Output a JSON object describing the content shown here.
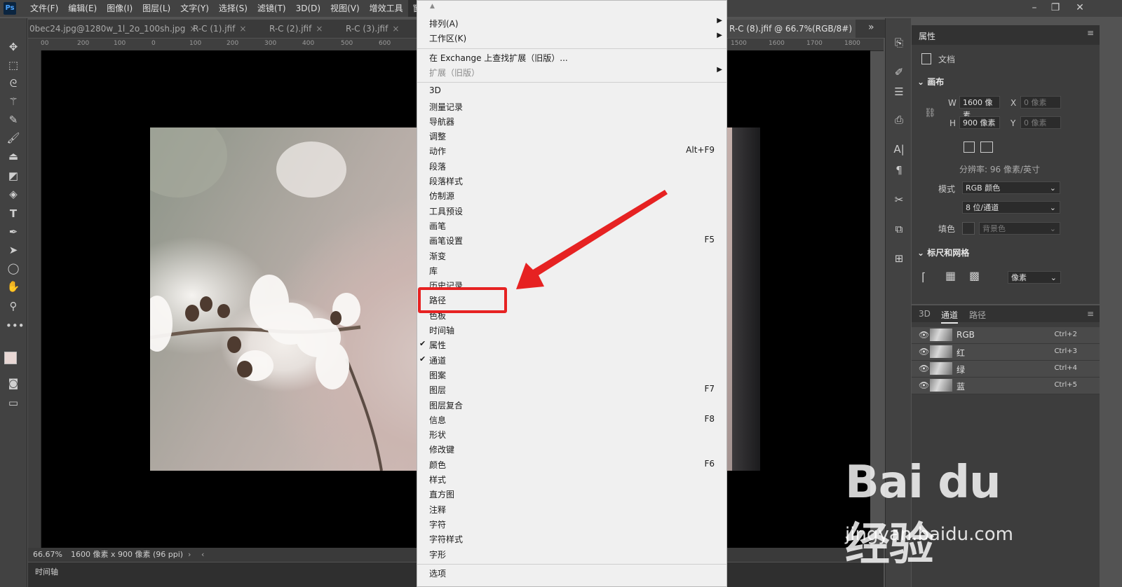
{
  "app": {
    "logo": "Ps"
  },
  "menubar": {
    "items": [
      "文件(F)",
      "编辑(E)",
      "图像(I)",
      "图层(L)",
      "文字(Y)",
      "选择(S)",
      "滤镜(T)",
      "3D(D)",
      "视图(V)",
      "增效工具",
      "窗口(W)"
    ],
    "active": "窗口(W)"
  },
  "tabs": [
    {
      "label": "0bec24.jpg@1280w_1l_2o_100sh.jpg"
    },
    {
      "label": "R-C (1).jfif"
    },
    {
      "label": "R-C (2).jfif"
    },
    {
      "label": "R-C (3).jfif"
    },
    {
      "label": "R-C (8).jfif @ 66.7%(RGB/8#)"
    }
  ],
  "ruler_ticks": [
    "00",
    "200",
    "100",
    "0",
    "100",
    "200",
    "300",
    "400",
    "500",
    "600",
    "1500",
    "1600",
    "1700",
    "1800"
  ],
  "status": {
    "zoom": "66.67%",
    "doc_info": "1600 像素 x 900 像素 (96 ppi)"
  },
  "timeline_label": "时间轴",
  "window_menu": {
    "groups": [
      [
        {
          "label": "排列(A)",
          "submenu": true
        },
        {
          "label": "工作区(K)",
          "submenu": true
        }
      ],
      [
        {
          "label": "在 Exchange 上查找扩展（旧版）..."
        },
        {
          "label": "扩展（旧版）",
          "submenu": true,
          "disabled": true
        }
      ],
      [
        {
          "label": "3D"
        },
        {
          "label": "测量记录"
        },
        {
          "label": "导航器"
        },
        {
          "label": "调整"
        },
        {
          "label": "动作",
          "shortcut": "Alt+F9"
        },
        {
          "label": "段落"
        },
        {
          "label": "段落样式"
        },
        {
          "label": "仿制源"
        },
        {
          "label": "工具预设"
        },
        {
          "label": "画笔"
        },
        {
          "label": "画笔设置",
          "shortcut": "F5"
        },
        {
          "label": "渐变"
        },
        {
          "label": "库"
        },
        {
          "label": "历史记录"
        },
        {
          "label": "路径"
        },
        {
          "label": "色板"
        },
        {
          "label": "时间轴"
        },
        {
          "label": "属性",
          "checked": true
        },
        {
          "label": "通道",
          "checked": true
        },
        {
          "label": "图案"
        },
        {
          "label": "图层",
          "shortcut": "F7"
        },
        {
          "label": "图层复合"
        },
        {
          "label": "信息",
          "shortcut": "F8"
        },
        {
          "label": "形状"
        },
        {
          "label": "修改键"
        },
        {
          "label": "颜色",
          "shortcut": "F6"
        },
        {
          "label": "样式"
        },
        {
          "label": "直方图"
        },
        {
          "label": "注释"
        },
        {
          "label": "字符"
        },
        {
          "label": "字符样式"
        },
        {
          "label": "字形"
        }
      ],
      [
        {
          "label": "选项"
        }
      ]
    ],
    "highlighted": "路径"
  },
  "properties": {
    "title": "属性",
    "doc_label": "文档",
    "canvas_section": "画布",
    "w_label": "W",
    "w_value": "1600 像素",
    "h_label": "H",
    "h_value": "900 像素",
    "x_label": "X",
    "x_value": "0 像素",
    "y_label": "Y",
    "y_value": "0 像素",
    "resolution": "分辨率: 96 像素/英寸",
    "mode_label": "模式",
    "mode_value": "RGB 颜色",
    "depth_value": "8 位/通道",
    "fill_label": "填色",
    "fill_value": "背景色",
    "rulers_section": "标尺和网格",
    "units_value": "像素"
  },
  "channels": {
    "tabs": [
      "3D",
      "通道",
      "路径"
    ],
    "active_tab": "通道",
    "rows": [
      {
        "name": "RGB",
        "shortcut": "Ctrl+2"
      },
      {
        "name": "红",
        "shortcut": "Ctrl+3"
      },
      {
        "name": "绿",
        "shortcut": "Ctrl+4"
      },
      {
        "name": "蓝",
        "shortcut": "Ctrl+5"
      }
    ]
  },
  "watermark": {
    "logo": "Bai du 经验",
    "site": "jingyan.baidu.com"
  },
  "colors": {
    "highlight": "#e62222",
    "menu_bg": "#f0f0f0",
    "canvas_bg": "#000000",
    "panel_bg": "#3d3d3d"
  }
}
